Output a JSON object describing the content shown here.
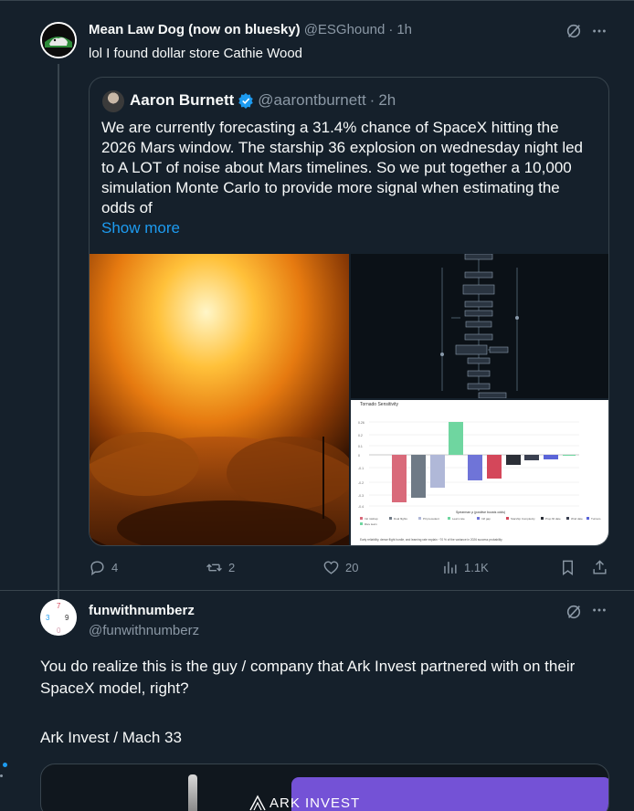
{
  "tweet1": {
    "display_name": "Mean Law Dog (now on bluesky)",
    "handle": "@ESGhound",
    "separator": "·",
    "time": "1h",
    "text": "lol I found dollar store Cathie Wood"
  },
  "quote": {
    "display_name": "Aaron Burnett",
    "handle": "@aarontburnett",
    "separator": "·",
    "time": "2h",
    "text": "We are currently forecasting a 31.4% chance of SpaceX hitting the 2026 Mars window. The starship 36 explosion on wednesday night led to A LOT of noise about Mars timelines. So we put together a 10,000 simulation Monte Carlo to provide more signal when estimating the odds of",
    "show_more": "Show more",
    "chart_title": "Tornado Sensitivity",
    "chart_xlabel": "Spearman ρ (positive boosts odds)",
    "chart_caption": "Early reliability, dense flight hurdle, and learning rate explain ~70 % of the variance in 2026 success probability"
  },
  "actions": {
    "replies": "4",
    "reposts": "2",
    "likes": "20",
    "views": "1.1K"
  },
  "tweet2": {
    "display_name": "funwithnumberz",
    "handle": "@funwithnumberz",
    "text": "You do realize this is the guy / company that Ark Invest partnered with on their SpaceX model, right?",
    "text2": "Ark Invest / Mach 33",
    "card_label": "ARK INVEST"
  },
  "colors": {
    "background": "#15202b",
    "text": "#f7f9f9",
    "muted": "#8b98a5",
    "accent": "#1d9bf0",
    "border": "#38444d",
    "ark_purple": "#7452d6"
  },
  "icons": [
    "grok-icon",
    "more-icon",
    "verified-badge-icon",
    "reply-icon",
    "repost-icon",
    "like-icon",
    "views-icon",
    "bookmark-icon",
    "share-icon",
    "ark-logo-icon"
  ]
}
